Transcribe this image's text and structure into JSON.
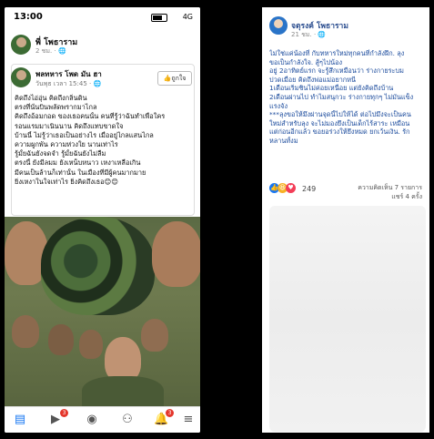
{
  "left": {
    "status": {
      "time": "13:00",
      "network": "4G"
    },
    "post": {
      "author": "พี่ โพธาราม",
      "meta": "2 ชม. · "
    },
    "quoted": {
      "name": "พลทหาร โพด มัน ฮา",
      "time": "วันพุธ เวลา 15:45 · ",
      "like_button": "ถูกใจ",
      "lines": [
        "คิดถึงไอ่อุ่น คิดถึงกลิ่นดิน",
        "ตรงที่นั่นบินพลัดพรากมาไกล",
        "คิดถึงอ้อมกอด ของเธอคนนั้น คนที่รู้ว่าฉันทำเพื่อใคร",
        "รอนแรมมาเนินนาน คิดถึงแทบขาดใจ",
        "บ้านนี้ ไม่รู้ว่าเธอเป็นอย่างไร เมื่ออยู่ไกลแสนไกล",
        "ความผูกพัน ความห่วงใย นานเท่าไร",
        "รู้มั้ยฉันยังจดจำ รู้มั้ยฉันยังไม่ลืม",
        "ตรงนี้ ยังมีลมม ยังเหน็บหนาว เหงาเหลือเกิน",
        "มีคนเป็นล้านก็เท่านั้น ในเมืองที่มีผู้คนมากมาย",
        "ยิ่งเหงาในใจเท่าไร ยิ่งคิดถึงเธอ😊😊"
      ]
    }
  },
  "right": {
    "author": "จตุรงค์ โพธาราม",
    "meta": "21 ชม. · ",
    "lines": [
      "ไม่ใช่แค่น้องที่ กับทหารใหม่ทุกคนที่กำลังฝึก. ลุง",
      "ขอเป็นกำลังใจ. สู้ๆไปน้อง",
      "อยู่ 2อาทิตย์แรก จะรู้สึกเหมือนว่า ร่างกายระบม",
      "ปวดเมื่อย คิดถึงพ่อแม่อยากหนี",
      "1เดือนเริ่มชินไม่ค่อยเหนื่อย แต่ยังคิดถึงบ้าน",
      "2เดือนผ่านไป ทำไมสนุกวะ ร่างกายทุกๆ ไม่มันแข็ง",
      "แรงจัง",
      "***ลุงขอให้มึงผ่านจุดนี้ไปให้ได้ ต่อไปมึงจะเป็นคน",
      "ใหม่สำหรับลุง จะไม่มองยึงเป็นเด็กไร้สาระ เหมือน",
      "แต่ก่อนอีกแล้ว ขอยอร่วงให้ยึงหมด ยกเว้นเงิน. รัก",
      "หลานทั้งม"
    ],
    "reaction_count": "249",
    "comments": "ความคิดเห็น 7 รายการ",
    "shares": "แชร์ 4 ครั้ง"
  },
  "colors": {
    "link": "#2a4d8f",
    "text_blue": "#1a4a9c",
    "badge": "#e4362b"
  },
  "icons": [
    "home-icon",
    "video-icon",
    "profile-icon",
    "groups-icon",
    "bell-icon",
    "menu-icon",
    "globe-icon",
    "like-icon"
  ]
}
